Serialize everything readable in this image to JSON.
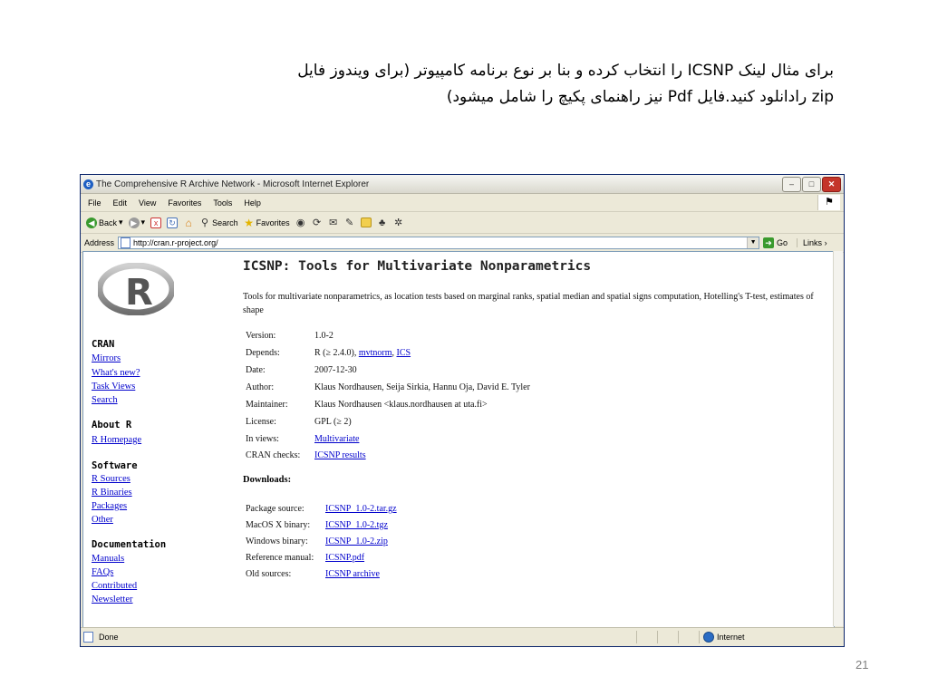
{
  "slide": {
    "caption_line1": "برای مثال لینک ICSNP را انتخاب کرده و بنا بر نوع برنامه کامپیوتر (برای ویندوز فایل",
    "caption_line2": "zip رادانلود کنید.فایل  Pdf نیز راهنمای پکیچ را شامل میشود)",
    "page_number": "21"
  },
  "browser": {
    "title": "The Comprehensive R Archive Network - Microsoft Internet Explorer",
    "menu": [
      "File",
      "Edit",
      "View",
      "Favorites",
      "Tools",
      "Help"
    ],
    "toolbar": {
      "back": "Back",
      "search": "Search",
      "favorites": "Favorites"
    },
    "address_label": "Address",
    "address_url": "http://cran.r-project.org/",
    "go_label": "Go",
    "links_label": "Links",
    "status_text": "Done",
    "zone_text": "Internet"
  },
  "sidebar": {
    "sections": [
      {
        "title": "CRAN",
        "links": [
          "Mirrors",
          "What's new?",
          "Task Views",
          "Search"
        ]
      },
      {
        "title": "About R",
        "links": [
          "R Homepage"
        ]
      },
      {
        "title": "Software",
        "links": [
          "R Sources",
          "R Binaries",
          "Packages",
          "Other"
        ]
      },
      {
        "title": "Documentation",
        "links": [
          "Manuals",
          "FAQs",
          "Contributed",
          "Newsletter"
        ]
      }
    ]
  },
  "package": {
    "title": "ICSNP: Tools for Multivariate Nonparametrics",
    "description": "Tools for multivariate nonparametrics, as location tests based on marginal ranks, spatial median and spatial signs computation, Hotelling's T-test, estimates of shape",
    "meta": [
      {
        "key": "Version:",
        "value": "1.0-2"
      },
      {
        "key": "Depends:",
        "value_prefix": "R (≥ 2.4.0), ",
        "links": [
          "mvtnorm",
          "ICS"
        ]
      },
      {
        "key": "Date:",
        "value": "2007-12-30"
      },
      {
        "key": "Author:",
        "value": "Klaus Nordhausen, Seija Sirkia, Hannu Oja, David E. Tyler"
      },
      {
        "key": "Maintainer:",
        "value": "Klaus Nordhausen <klaus.nordhausen at uta.fi>"
      },
      {
        "key": "License:",
        "value": "GPL (≥ 2)"
      },
      {
        "key": "In views:",
        "link": "Multivariate"
      },
      {
        "key": "CRAN checks:",
        "link": "ICSNP results"
      }
    ],
    "downloads_heading": "Downloads:",
    "downloads": [
      {
        "key": "Package source:",
        "link": "ICSNP_1.0-2.tar.gz"
      },
      {
        "key": "MacOS X binary:",
        "link": "ICSNP_1.0-2.tgz"
      },
      {
        "key": "Windows binary:",
        "link": "ICSNP_1.0-2.zip"
      },
      {
        "key": "Reference manual:",
        "link": "ICSNP.pdf"
      },
      {
        "key": "Old sources:",
        "link": "ICSNP archive"
      }
    ]
  }
}
